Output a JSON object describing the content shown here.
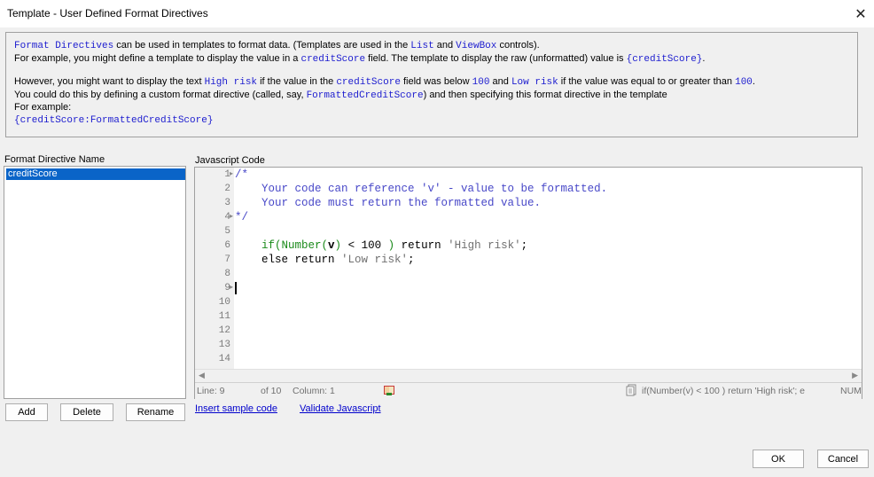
{
  "window": {
    "title": "Template - User Defined Format Directives",
    "close_glyph": "✕"
  },
  "info": {
    "l1_a": "Format Directives",
    "l1_b": " can be used in templates to format data. (Templates are used in the ",
    "l1_c": "List",
    "l1_d": " and ",
    "l1_e": "ViewBox",
    "l1_f": " controls).",
    "l2_a": "For example, you might define a template to display the value in a ",
    "l2_b": "creditScore",
    "l2_c": " field. The template to display the raw (unformatted) value is ",
    "l2_d": "{creditScore}",
    "l2_e": ".",
    "l3_a": "However, you might want to display the text ",
    "l3_b": "High risk",
    "l3_c": " if the value in the ",
    "l3_d": "creditScore",
    "l3_e": " field was below ",
    "l3_f": "100",
    "l3_g": " and ",
    "l3_h": "Low risk",
    "l3_i": " if the value was equal to or greater than ",
    "l3_j": "100",
    "l3_k": ".",
    "l4_a": "You could do this by defining a custom format directive (called, say, ",
    "l4_b": "FormattedCreditScore",
    "l4_c": ") and then specifying this format directive in the template",
    "l5": "For example:",
    "l6": "{creditScore:FormattedCreditScore}"
  },
  "directives": {
    "label": "Format Directive Name",
    "items": [
      "creditScore"
    ],
    "add_label": "Add",
    "delete_label": "Delete",
    "rename_label": "Rename"
  },
  "editor": {
    "label": "Javascript Code",
    "line_numbers": [
      "1",
      "2",
      "3",
      "4",
      "5",
      "6",
      "7",
      "8",
      "9",
      "10",
      "11",
      "12",
      "13",
      "14"
    ],
    "code": {
      "c1": "/*",
      "c2": "    Your code can reference 'v' - value to be formatted.",
      "c3": "    Your code must return the formatted value.",
      "c4": "*/",
      "c6_fn": "    if(Number(",
      "c6_v": "v",
      "c6_close": ")",
      "c6_mid": " < 100 ",
      "c6_paren": ")",
      "c6_ret": " return ",
      "c6_str": "'High risk'",
      "c6_end": ";",
      "c7_kw": "    else return ",
      "c7_str": "'Low risk'",
      "c7_end": ";"
    },
    "status": {
      "line": "Line: 9",
      "of": "of 10",
      "column": "Column: 1",
      "snippet": "if(Number(v) < 100 ) return 'High risk'; e",
      "num": "NUM"
    },
    "insert_sample": "Insert sample code",
    "validate": "Validate Javascript"
  },
  "footer": {
    "ok_label": "OK",
    "cancel_label": "Cancel"
  }
}
